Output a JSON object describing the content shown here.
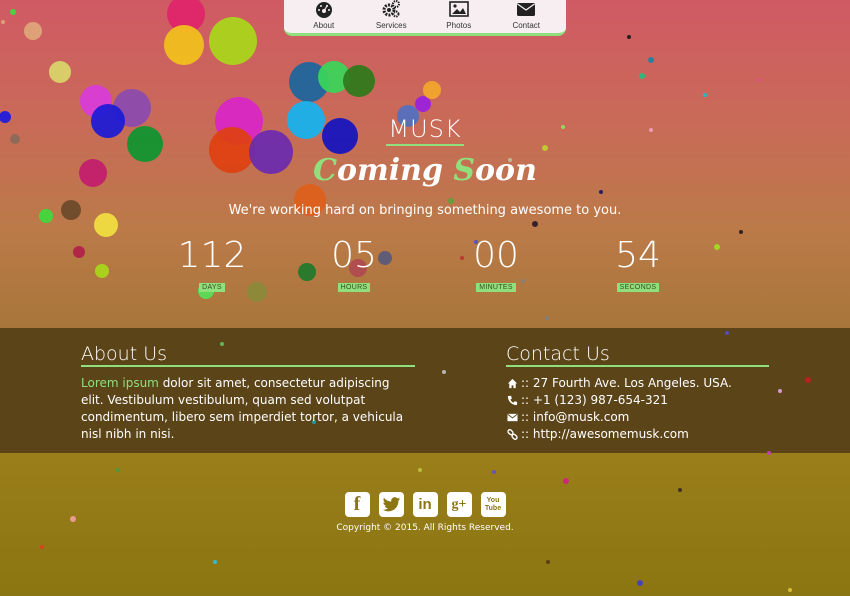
{
  "nav": {
    "items": [
      {
        "label": "About",
        "icon": "dashboard-icon"
      },
      {
        "label": "Services",
        "icon": "gears-icon"
      },
      {
        "label": "Photos",
        "icon": "picture-icon"
      },
      {
        "label": "Contact",
        "icon": "envelope-icon"
      }
    ]
  },
  "hero": {
    "brand": "MUSK",
    "coming_first": "C",
    "coming_mid": "oming ",
    "coming_second": "S",
    "coming_end": "oon",
    "tagline": "We're working hard on bringing something awesome to you."
  },
  "countdown": [
    {
      "value": "112",
      "label": "DAYS"
    },
    {
      "value": "05",
      "label": "HOURS"
    },
    {
      "value": "00",
      "label": "MINUTES"
    },
    {
      "value": "54",
      "label": "SECONDS"
    }
  ],
  "about": {
    "title": "About Us",
    "lead": "Lorem ipsum",
    "text": " dolor sit amet, consectetur adipiscing elit. Vestibulum vestibulum, quam sed volutpat condimentum, libero sem imperdiet tortor, a vehicula nisl nibh in nisi."
  },
  "contact": {
    "title": "Contact Us",
    "rows": [
      {
        "icon": "home-icon",
        "text": ":: 27 Fourth Ave. Los Angeles. USA."
      },
      {
        "icon": "phone-icon",
        "text": ":: +1 (123) 987-654-321"
      },
      {
        "icon": "envelope-icon",
        "text": ":: info@musk.com"
      },
      {
        "icon": "link-icon",
        "text": ":: http://awesomemusk.com"
      }
    ]
  },
  "socials": [
    {
      "icon": "facebook-icon",
      "glyph": "f"
    },
    {
      "icon": "twitter-icon",
      "glyph": "t"
    },
    {
      "icon": "linkedin-icon",
      "glyph": "in"
    },
    {
      "icon": "googleplus-icon",
      "glyph": "g+"
    },
    {
      "icon": "youtube-icon",
      "glyph": "You Tube"
    }
  ],
  "footer": {
    "copyright": "Copyright © 2015. All Rights Reserved."
  },
  "colors": {
    "accent": "#8fe07d",
    "band_dark": "#5c4419",
    "footer_bg": "#8a7612"
  }
}
